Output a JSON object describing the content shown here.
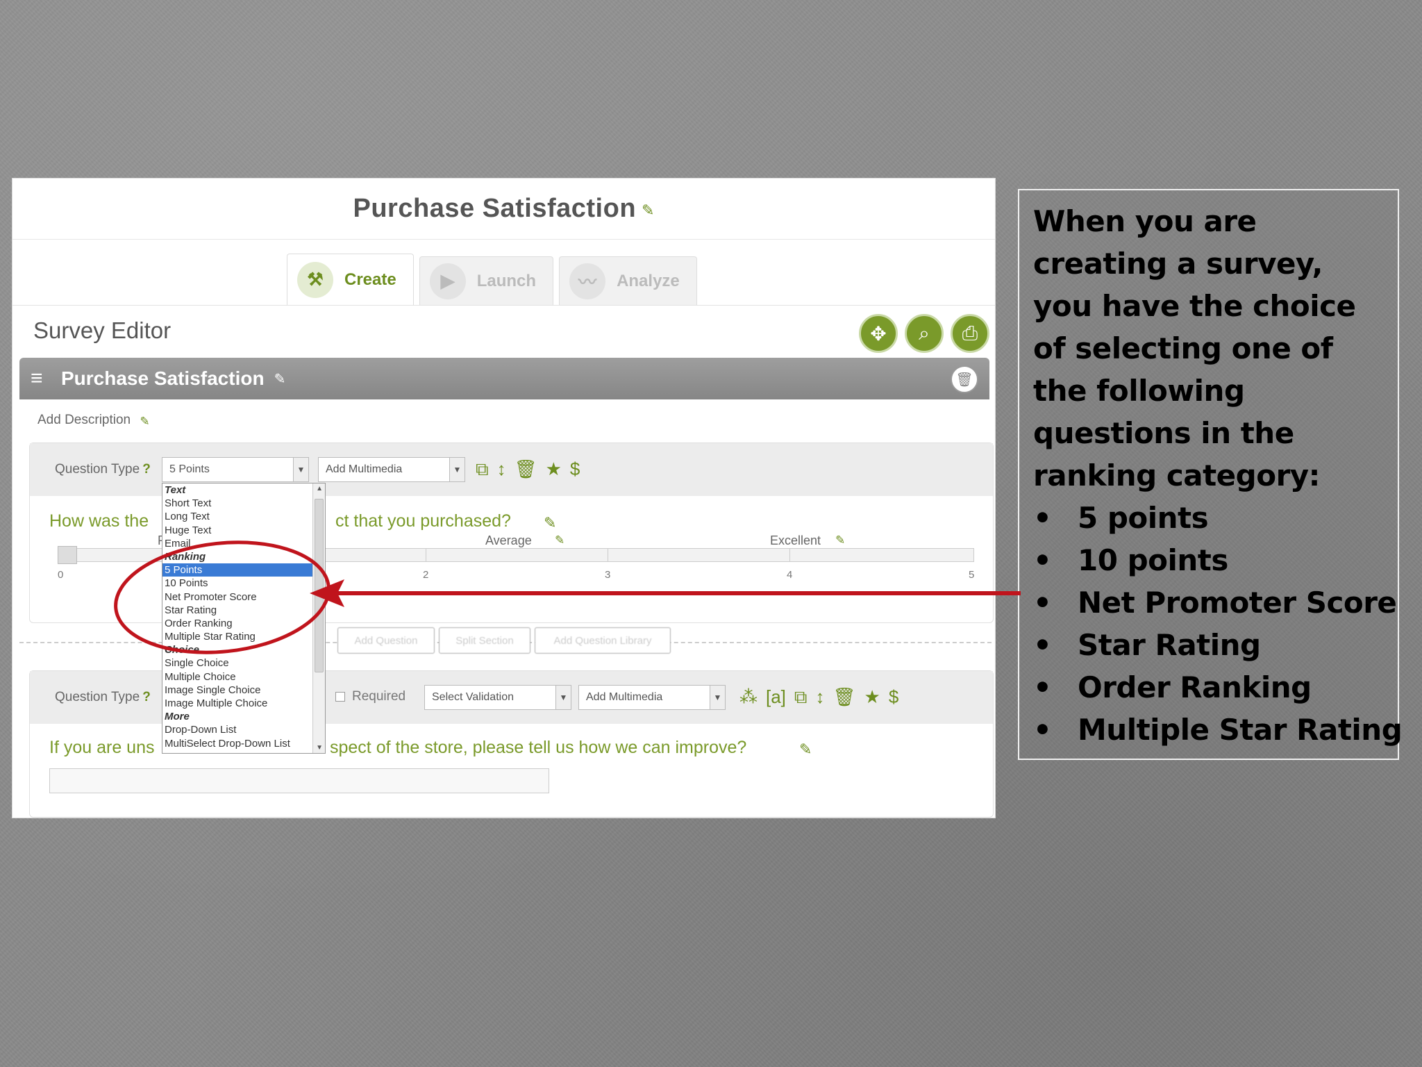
{
  "screenshot": {
    "page_title": "Purchase Satisfaction",
    "tabs": [
      {
        "label": "Create",
        "icon": "tools-icon"
      },
      {
        "label": "Launch",
        "icon": "play-icon"
      },
      {
        "label": "Analyze",
        "icon": "chart-icon"
      }
    ],
    "editor_title": "Survey Editor",
    "section_title": "Purchase Satisfaction",
    "add_description": "Add Description",
    "question1": {
      "type_label": "Question Type",
      "help": "?",
      "type_value": "5 Points",
      "multimedia": "Add Multimedia",
      "text_start": "How was the",
      "text_end": "ct that you purchased?",
      "scale_labels": {
        "left_partial": "P",
        "average": "Average",
        "excellent": "Excellent"
      },
      "ticks": [
        "0",
        "2",
        "3",
        "4",
        "5"
      ]
    },
    "section_buttons": [
      "Add Question",
      "Split Section",
      "Add Question Library"
    ],
    "dropdown_items": [
      {
        "label": "Text",
        "group": true
      },
      {
        "label": "Short Text"
      },
      {
        "label": "Long Text"
      },
      {
        "label": "Huge Text"
      },
      {
        "label": "Email"
      },
      {
        "label": "Ranking",
        "group": true
      },
      {
        "label": "5 Points",
        "selected": true
      },
      {
        "label": "10 Points"
      },
      {
        "label": "Net Promoter Score"
      },
      {
        "label": "Star Rating"
      },
      {
        "label": "Order Ranking"
      },
      {
        "label": "Multiple Star Rating"
      },
      {
        "label": "Choice",
        "group": true
      },
      {
        "label": "Single Choice"
      },
      {
        "label": "Multiple Choice"
      },
      {
        "label": "Image Single Choice"
      },
      {
        "label": "Image Multiple Choice"
      },
      {
        "label": "More",
        "group": true
      },
      {
        "label": "Drop-Down List"
      },
      {
        "label": "MultiSelect Drop-Down List"
      }
    ],
    "question2": {
      "type_label": "Question Type",
      "help": "?",
      "required": "Required",
      "validation": "Select Validation",
      "multimedia": "Add Multimedia",
      "text_start": "If you are uns",
      "text_end": "spect of the store, please tell us how we can improve?"
    },
    "accent_color": "#6d8e1f",
    "annotation_color": "#c0141c"
  },
  "explanation": {
    "intro": "When you are creating a survey, you have the choice of selecting one of the following questions in the ranking category:",
    "items": [
      "5 points",
      "10 points",
      "Net Promoter Score",
      "Star Rating",
      "Order Ranking",
      "Multiple Star Rating"
    ]
  }
}
